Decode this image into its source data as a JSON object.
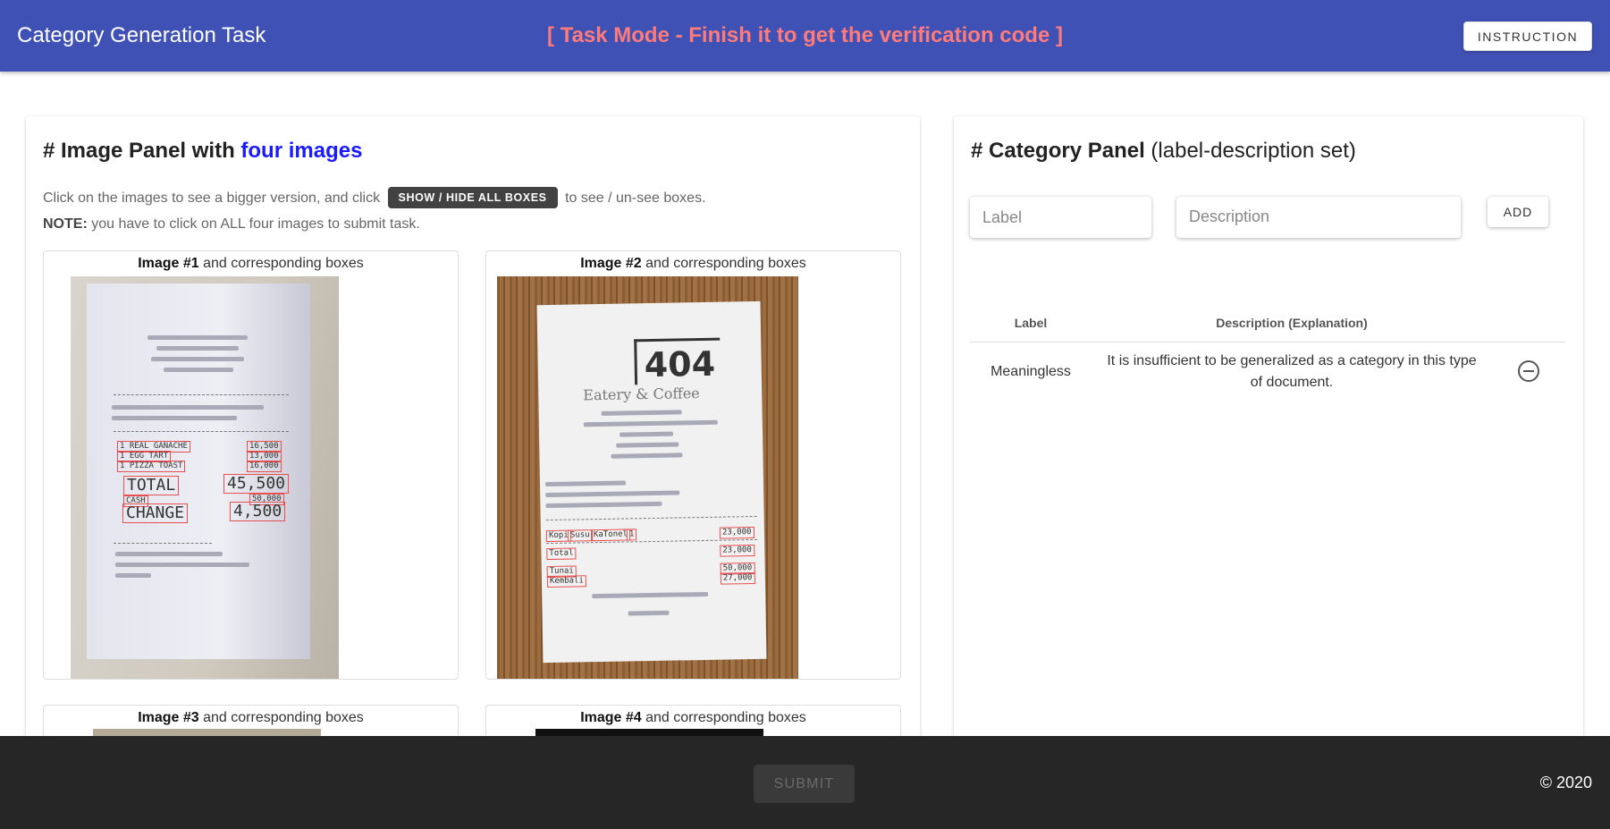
{
  "appbar": {
    "title": "Category Generation Task",
    "mode": "[ Task Mode - Finish it to get the verification code ]",
    "instruction_label": "INSTRUCTION",
    "colors": {
      "bar": "#3f51b5",
      "mode_text": "#ff7b7b"
    }
  },
  "image_panel": {
    "title_prefix": "# Image Panel with ",
    "title_highlight": "four images",
    "helper_before": "Click on the images to see a bigger version, and click",
    "toggle_boxes_label": "SHOW / HIDE ALL BOXES",
    "helper_after": "to see / un-see boxes.",
    "note_label": "NOTE:",
    "note_text": "you have to click on ALL four images to submit task.",
    "images": [
      {
        "name": "Image #1",
        "caption_suffix": "and corresponding boxes",
        "boxes": [
          "1 REAL GANACHE",
          "1 EGG TART",
          "1 PIZZA TOAST",
          "16,500",
          "13,000",
          "16,000",
          "TOTAL",
          "45,500",
          "CASH",
          "50,000",
          "CHANGE",
          "4,500"
        ]
      },
      {
        "name": "Image #2",
        "caption_suffix": "and corresponding boxes",
        "logo": "404",
        "logo_sub": "Eatery & Coffee",
        "boxes": [
          "Kopi",
          "Susu",
          "KaTonel",
          "1",
          "23,000",
          "Total",
          "23,000",
          "Tunai",
          "50,000",
          "Kembali",
          "27,000"
        ]
      },
      {
        "name": "Image #3",
        "caption_suffix": "and corresponding boxes"
      },
      {
        "name": "Image #4",
        "caption_suffix": "and corresponding boxes"
      }
    ]
  },
  "category_panel": {
    "title_bold": "# Category Panel",
    "title_rest": "(label-description set)",
    "label_placeholder": "Label",
    "description_placeholder": "Description",
    "add_label": "ADD",
    "table_headers": {
      "label": "Label",
      "description": "Description (Explanation)"
    },
    "rows": [
      {
        "label": "Meaningless",
        "description": "It is insufficient to be generalized as a category in this type of document."
      }
    ]
  },
  "footer": {
    "submit_label": "SUBMIT",
    "copyright": "© 2020"
  }
}
